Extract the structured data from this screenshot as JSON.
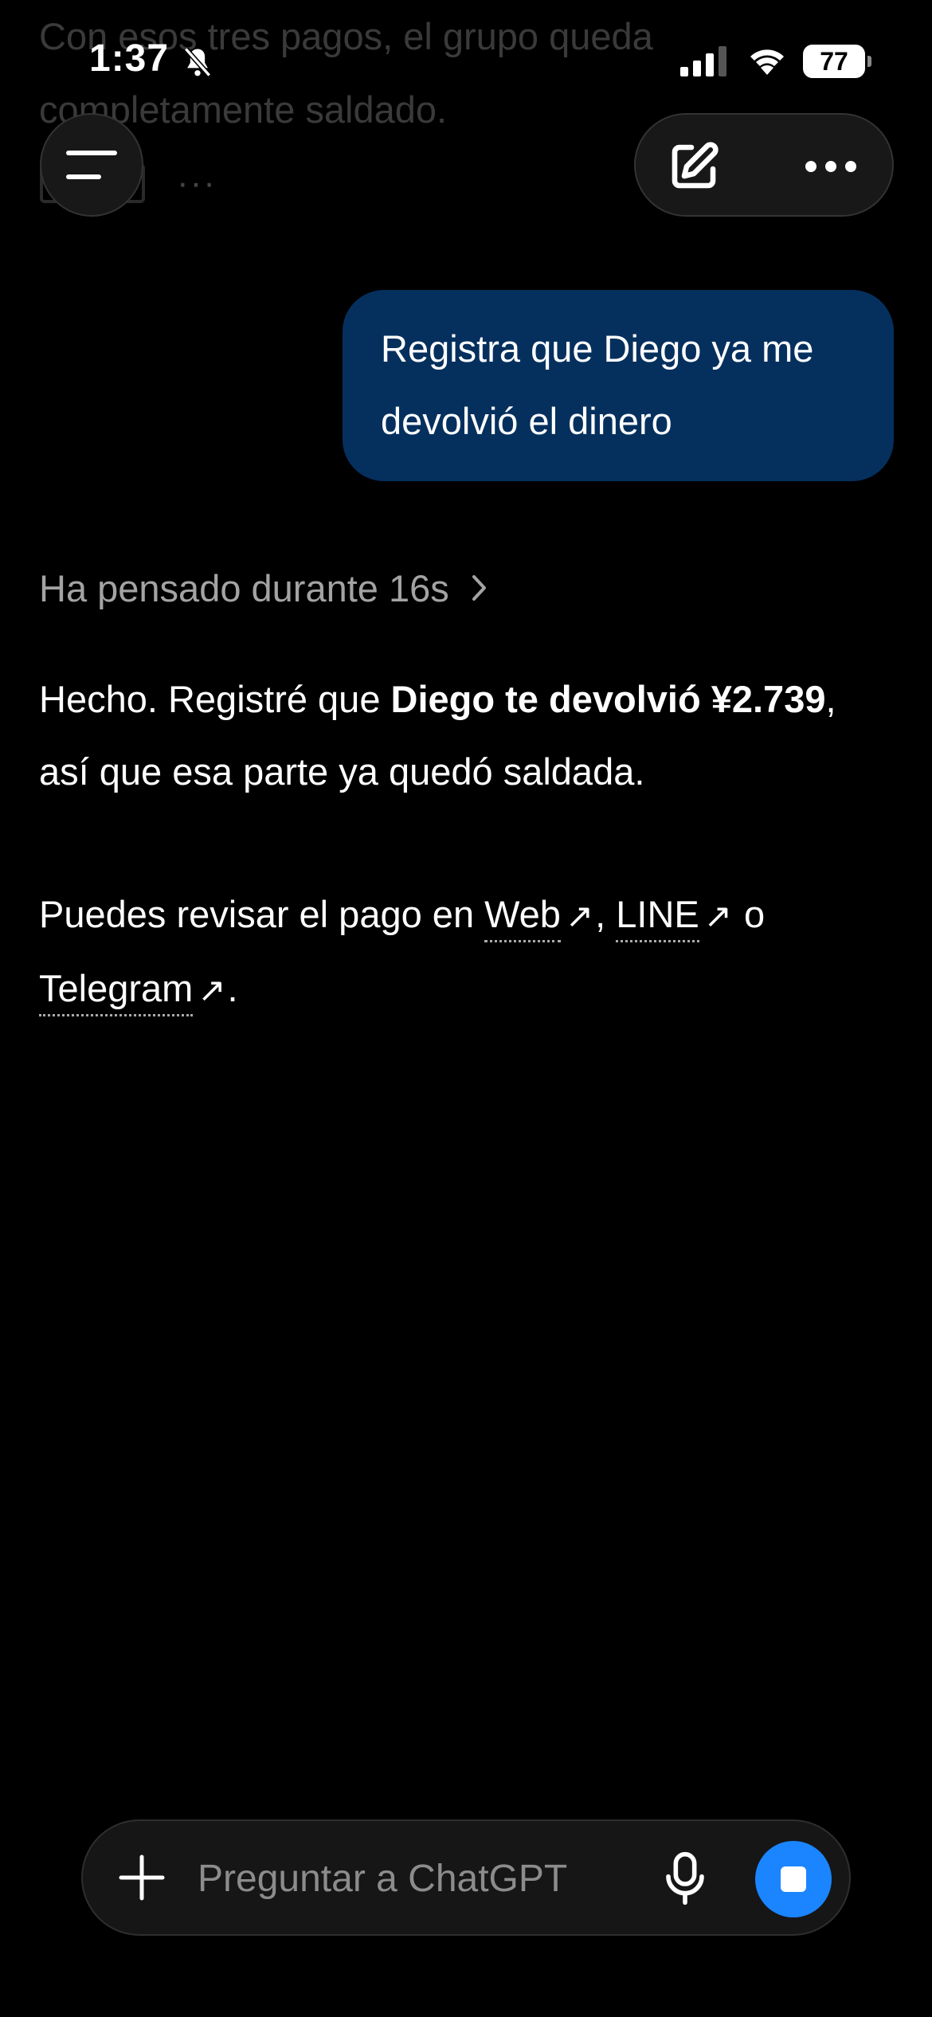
{
  "previous_message": {
    "text": "Con esos tres pagos, el grupo queda completamente saldado.",
    "actions_more": "···"
  },
  "status_bar": {
    "time": "1:37",
    "battery": "77"
  },
  "header": {
    "menu_icon": "hamburger-menu-icon",
    "new_chat_icon": "compose-icon",
    "more_icon": "ellipsis-icon"
  },
  "user_message": {
    "text": "Registra que Diego ya me devolvió el dinero"
  },
  "thought": {
    "label": "Ha pensado durante 16s"
  },
  "assistant": {
    "p1_prefix": "Hecho. Registré que ",
    "p1_bold": "Diego te devolvió ¥2.739",
    "p1_suffix": ", así que esa parte ya quedó saldada.",
    "p2_prefix": "Puedes revisar el pago en ",
    "link_web": "Web",
    "sep1": ", ",
    "link_line": "LINE",
    "sep2": " o ",
    "link_telegram": "Telegram",
    "p2_suffix": ".",
    "external_arrow": "↗"
  },
  "composer": {
    "placeholder": "Preguntar a ChatGPT",
    "accent_color": "#1a85ff"
  }
}
